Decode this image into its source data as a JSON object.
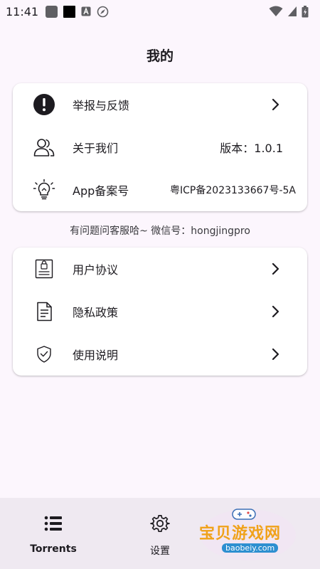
{
  "status_bar": {
    "time": "11:41"
  },
  "header": {
    "title": "我的"
  },
  "card1": {
    "items": [
      {
        "label": "举报与反馈",
        "icon": "alert-circle-icon"
      },
      {
        "label": "关于我们",
        "value": "版本：1.0.1",
        "icon": "users-icon"
      },
      {
        "label": "App备案号",
        "value": "粤ICP备2023133667号-5A",
        "icon": "lightbulb-icon"
      }
    ]
  },
  "contact_note": "有问题问客服哈~ 微信号：hongjingpro",
  "card2": {
    "items": [
      {
        "label": "用户协议",
        "icon": "agreement-icon"
      },
      {
        "label": "隐私政策",
        "icon": "document-icon"
      },
      {
        "label": "使用说明",
        "icon": "shield-check-icon"
      }
    ]
  },
  "bottom_nav": {
    "items": [
      {
        "label": "Torrents",
        "icon": "list-icon",
        "active": true
      },
      {
        "label": "设置",
        "icon": "gear-icon",
        "active": false
      }
    ]
  },
  "watermark": {
    "main": "宝贝游戏网",
    "sub": "baobeiy.com"
  }
}
